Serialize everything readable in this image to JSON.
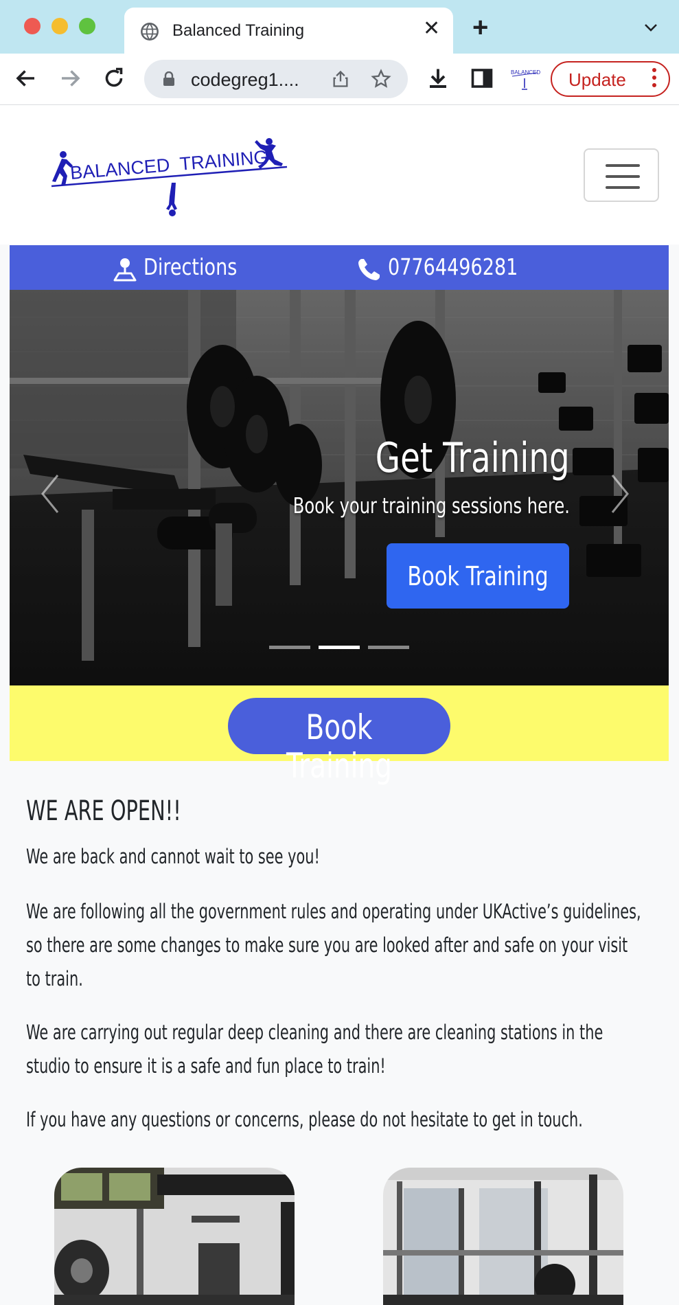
{
  "browser": {
    "tab_title": "Balanced Training",
    "url": "codegreg1....",
    "update_label": "Update"
  },
  "site": {
    "logo_text": "BALANCED  TRAINING",
    "logo_text_small": "BALANCED TRAINING"
  },
  "contact_bar": {
    "directions_label": "Directions",
    "phone": "07764496281"
  },
  "hero": {
    "title": "Get Training",
    "subtitle": "Book your training sessions here.",
    "button_label": "Book Training",
    "slides_total": 3,
    "active_slide": 2
  },
  "booking_strip": {
    "button_label": "Book Training",
    "background": "#fdfb6c",
    "accent": "#4a5fdb"
  },
  "content": {
    "heading": "WE ARE OPEN!!",
    "paragraphs": [
      "We are back and cannot wait to see you!",
      "We are following all the government rules and operating under UKActive’s guidelines, so there are some changes to make sure you are looked after and safe on your visit to train.",
      "We are carrying out regular deep cleaning and there are cleaning stations in the studio to ensure it is a safe and fun place to train!",
      "If you have any questions or concerns, please do not hesitate to get in touch."
    ]
  },
  "icons": [
    "globe-icon",
    "close-icon",
    "plus-icon",
    "chevron-down-icon",
    "back-icon",
    "forward-icon",
    "reload-icon",
    "lock-icon",
    "share-icon",
    "star-icon",
    "download-icon",
    "sidepanel-icon",
    "map-pin-icon",
    "phone-icon",
    "chevron-left-icon",
    "chevron-right-icon",
    "hamburger-icon"
  ]
}
